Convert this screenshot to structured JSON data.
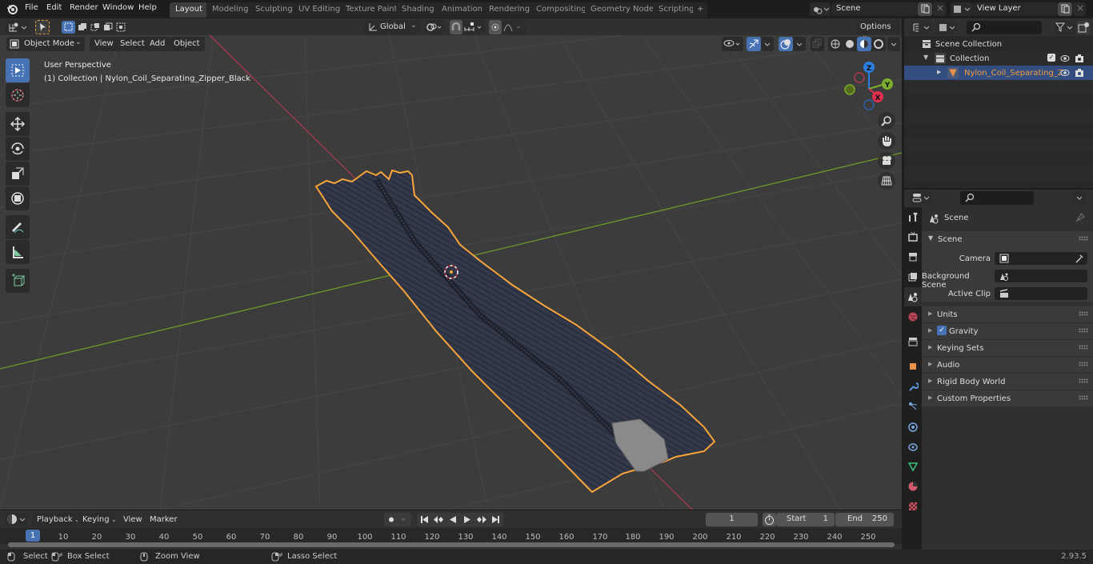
{
  "topbar": {
    "menus": [
      "File",
      "Edit",
      "Render",
      "Window",
      "Help"
    ],
    "workspaces": [
      "Layout",
      "Modeling",
      "Sculpting",
      "UV Editing",
      "Texture Paint",
      "Shading",
      "Animation",
      "Rendering",
      "Compositing",
      "Geometry Nodes",
      "Scripting"
    ],
    "active_workspace": "Layout",
    "add_workspace": "+",
    "scene_name": "Scene",
    "view_layer": "View Layer"
  },
  "viewport_header": {
    "mode": "Object Mode",
    "menus": [
      "View",
      "Select",
      "Add",
      "Object"
    ],
    "transform_orientation": "Global",
    "options_label": "Options"
  },
  "viewport": {
    "perspective_label": "User Perspective",
    "object_label": "(1) Collection | Nylon_Coil_Separating_Zipper_Black",
    "gizmo": {
      "x": "X",
      "y": "Y",
      "z": "Z"
    },
    "colors": {
      "selection_outline": "#f7a43a",
      "x_axis": "#c4334d",
      "y_axis": "#7dad2c",
      "grid_bg": "#3c3c3c"
    }
  },
  "outliner": {
    "root": "Scene Collection",
    "collection": "Collection",
    "object": "Nylon_Coil_Separating_Z"
  },
  "properties": {
    "context_title": "Scene",
    "section": "Scene",
    "fields": [
      {
        "label": "Camera",
        "value": ""
      },
      {
        "label": "Background Scene",
        "value": ""
      },
      {
        "label": "Active Clip",
        "value": ""
      }
    ],
    "panels": [
      "Units",
      "Gravity",
      "Keying Sets",
      "Audio",
      "Rigid Body World",
      "Custom Properties"
    ],
    "gravity_checked": true
  },
  "timeline": {
    "menus": [
      "Playback",
      "Keying",
      "View",
      "Marker"
    ],
    "current_frame": "1",
    "start_label": "Start",
    "start": "1",
    "end_label": "End",
    "end": "250",
    "ticks": [
      "10",
      "20",
      "30",
      "40",
      "50",
      "60",
      "70",
      "80",
      "90",
      "100",
      "110",
      "120",
      "130",
      "140",
      "150",
      "160",
      "170",
      "180",
      "190",
      "200",
      "210",
      "220",
      "230",
      "240",
      "250"
    ],
    "playhead": "1"
  },
  "statusbar": {
    "select": "Select",
    "box_select": "Box Select",
    "zoom_view": "Zoom View",
    "lasso_select": "Lasso Select",
    "version": "2.93.5"
  }
}
